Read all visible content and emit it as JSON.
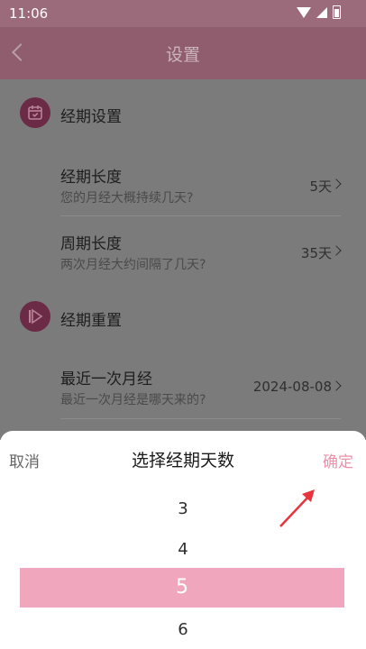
{
  "status": {
    "time": "11:06"
  },
  "appbar": {
    "title": "设置"
  },
  "sections": [
    {
      "title": "经期设置",
      "icon": "calendar-icon",
      "rows": [
        {
          "title": "经期长度",
          "subtitle": "您的月经大概持续几天?",
          "value": "5天"
        },
        {
          "title": "周期长度",
          "subtitle": "两次月经大约间隔了几天?",
          "value": "35天"
        }
      ]
    },
    {
      "title": "经期重置",
      "icon": "play-icon",
      "rows": [
        {
          "title": "最近一次月经",
          "subtitle": "最近一次月经是哪天来的?",
          "value": "2024-08-08"
        }
      ]
    }
  ],
  "sheet": {
    "cancel": "取消",
    "title": "选择经期天数",
    "confirm": "确定",
    "options": [
      "3",
      "4",
      "5",
      "6"
    ],
    "selected": "5"
  },
  "colors": {
    "accent": "#ef8faa",
    "selection": "#f0a7bd",
    "appbar": "#8f5d6e",
    "annotation_arrow": "#e8343c"
  }
}
